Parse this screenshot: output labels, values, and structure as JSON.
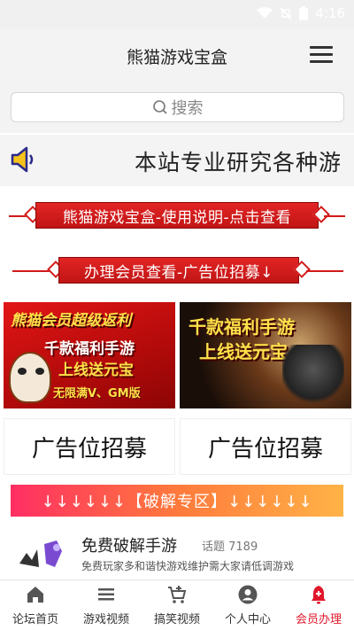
{
  "status_bar": {
    "time": "4:16"
  },
  "header": {
    "title": "熊猫游戏宝盒"
  },
  "search": {
    "placeholder": "搜索"
  },
  "notice": {
    "text": "本站专业研究各种游"
  },
  "banners": [
    {
      "label": "熊猫游戏宝盒-使用说明-点击查看"
    },
    {
      "label": "办理会员查看-广告位招募↓"
    }
  ],
  "ads": [
    {
      "line1": "熊猫会员超级返利",
      "line2": "千款福利手游",
      "line3": "上线送元宝",
      "line4": "无限满V、GM版"
    },
    {
      "line1": "千款福利手游",
      "line2": "上线送元宝"
    }
  ],
  "recruit": [
    {
      "label": "广告位招募"
    },
    {
      "label": "广告位招募"
    }
  ],
  "section": {
    "label": "↓↓↓↓↓↓【破解专区】↓↓↓↓↓↓"
  },
  "forum": {
    "title": "免费破解手游",
    "count": "话题 7189",
    "desc": "免费玩家多和谐快游戏维护需大家请低调游戏"
  },
  "tabs": [
    {
      "label": "论坛首页",
      "icon": "home-icon",
      "active": false
    },
    {
      "label": "游戏视频",
      "icon": "list-icon",
      "active": false
    },
    {
      "label": "搞笑视频",
      "icon": "cart-icon",
      "active": false
    },
    {
      "label": "个人中心",
      "icon": "user-icon",
      "active": false
    },
    {
      "label": "会员办理",
      "icon": "bell-icon",
      "active": true
    }
  ],
  "colors": {
    "accent": "#e0172b",
    "banner_red": "#d21a1a"
  }
}
